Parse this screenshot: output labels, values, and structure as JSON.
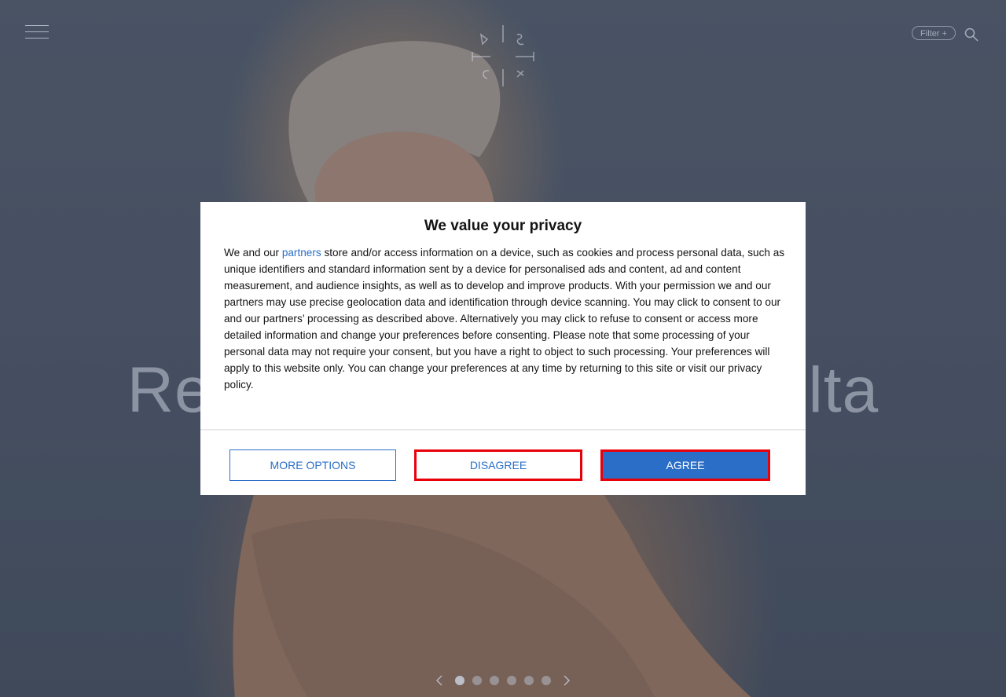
{
  "header": {
    "filter_label": "Filter +"
  },
  "hero": {
    "title_left": "Re",
    "title_right": "lta"
  },
  "consent": {
    "title": "We value your privacy",
    "body_prefix": "We and our ",
    "partners_link": "partners",
    "body_rest": " store and/or access information on a device, such as cookies and process personal data, such as unique identifiers and standard information sent by a device for personalised ads and content, ad and content measurement, and audience insights, as well as to develop and improve products. With your permission we and our partners may use precise geolocation data and identification through device scanning. You may click to consent to our and our partners’ processing as described above. Alternatively you may click to refuse to consent or access more detailed information and change your preferences before consenting. Please note that some processing of your personal data may not require your consent, but you have a right to object to such processing. Your preferences will apply to this website only. You can change your preferences at any time by returning to this site or visit our privacy policy.",
    "more_options_label": "MORE OPTIONS",
    "disagree_label": "DISAGREE",
    "agree_label": "AGREE"
  },
  "carousel": {
    "dot_count": 6,
    "active_index": 0
  },
  "colors": {
    "accent": "#2a6ec7",
    "highlight_border": "#e8000a",
    "modal_bg": "#ffffff"
  },
  "icons": {
    "menu": "hamburger-icon",
    "search": "search-icon",
    "prev": "chevron-left-icon",
    "next": "chevron-right-icon",
    "logo": "brand-logo"
  }
}
